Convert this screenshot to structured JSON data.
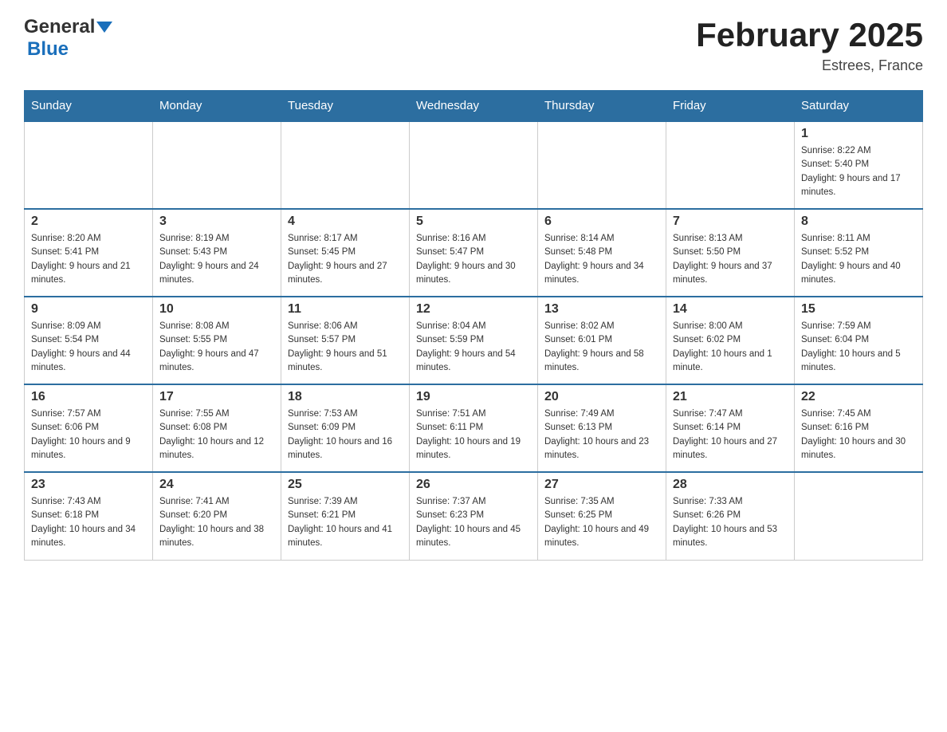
{
  "header": {
    "logo_general": "General",
    "logo_blue": "Blue",
    "month_title": "February 2025",
    "location": "Estrees, France"
  },
  "weekdays": [
    "Sunday",
    "Monday",
    "Tuesday",
    "Wednesday",
    "Thursday",
    "Friday",
    "Saturday"
  ],
  "weeks": [
    [
      {
        "day": "",
        "info": ""
      },
      {
        "day": "",
        "info": ""
      },
      {
        "day": "",
        "info": ""
      },
      {
        "day": "",
        "info": ""
      },
      {
        "day": "",
        "info": ""
      },
      {
        "day": "",
        "info": ""
      },
      {
        "day": "1",
        "info": "Sunrise: 8:22 AM\nSunset: 5:40 PM\nDaylight: 9 hours and 17 minutes."
      }
    ],
    [
      {
        "day": "2",
        "info": "Sunrise: 8:20 AM\nSunset: 5:41 PM\nDaylight: 9 hours and 21 minutes."
      },
      {
        "day": "3",
        "info": "Sunrise: 8:19 AM\nSunset: 5:43 PM\nDaylight: 9 hours and 24 minutes."
      },
      {
        "day": "4",
        "info": "Sunrise: 8:17 AM\nSunset: 5:45 PM\nDaylight: 9 hours and 27 minutes."
      },
      {
        "day": "5",
        "info": "Sunrise: 8:16 AM\nSunset: 5:47 PM\nDaylight: 9 hours and 30 minutes."
      },
      {
        "day": "6",
        "info": "Sunrise: 8:14 AM\nSunset: 5:48 PM\nDaylight: 9 hours and 34 minutes."
      },
      {
        "day": "7",
        "info": "Sunrise: 8:13 AM\nSunset: 5:50 PM\nDaylight: 9 hours and 37 minutes."
      },
      {
        "day": "8",
        "info": "Sunrise: 8:11 AM\nSunset: 5:52 PM\nDaylight: 9 hours and 40 minutes."
      }
    ],
    [
      {
        "day": "9",
        "info": "Sunrise: 8:09 AM\nSunset: 5:54 PM\nDaylight: 9 hours and 44 minutes."
      },
      {
        "day": "10",
        "info": "Sunrise: 8:08 AM\nSunset: 5:55 PM\nDaylight: 9 hours and 47 minutes."
      },
      {
        "day": "11",
        "info": "Sunrise: 8:06 AM\nSunset: 5:57 PM\nDaylight: 9 hours and 51 minutes."
      },
      {
        "day": "12",
        "info": "Sunrise: 8:04 AM\nSunset: 5:59 PM\nDaylight: 9 hours and 54 minutes."
      },
      {
        "day": "13",
        "info": "Sunrise: 8:02 AM\nSunset: 6:01 PM\nDaylight: 9 hours and 58 minutes."
      },
      {
        "day": "14",
        "info": "Sunrise: 8:00 AM\nSunset: 6:02 PM\nDaylight: 10 hours and 1 minute."
      },
      {
        "day": "15",
        "info": "Sunrise: 7:59 AM\nSunset: 6:04 PM\nDaylight: 10 hours and 5 minutes."
      }
    ],
    [
      {
        "day": "16",
        "info": "Sunrise: 7:57 AM\nSunset: 6:06 PM\nDaylight: 10 hours and 9 minutes."
      },
      {
        "day": "17",
        "info": "Sunrise: 7:55 AM\nSunset: 6:08 PM\nDaylight: 10 hours and 12 minutes."
      },
      {
        "day": "18",
        "info": "Sunrise: 7:53 AM\nSunset: 6:09 PM\nDaylight: 10 hours and 16 minutes."
      },
      {
        "day": "19",
        "info": "Sunrise: 7:51 AM\nSunset: 6:11 PM\nDaylight: 10 hours and 19 minutes."
      },
      {
        "day": "20",
        "info": "Sunrise: 7:49 AM\nSunset: 6:13 PM\nDaylight: 10 hours and 23 minutes."
      },
      {
        "day": "21",
        "info": "Sunrise: 7:47 AM\nSunset: 6:14 PM\nDaylight: 10 hours and 27 minutes."
      },
      {
        "day": "22",
        "info": "Sunrise: 7:45 AM\nSunset: 6:16 PM\nDaylight: 10 hours and 30 minutes."
      }
    ],
    [
      {
        "day": "23",
        "info": "Sunrise: 7:43 AM\nSunset: 6:18 PM\nDaylight: 10 hours and 34 minutes."
      },
      {
        "day": "24",
        "info": "Sunrise: 7:41 AM\nSunset: 6:20 PM\nDaylight: 10 hours and 38 minutes."
      },
      {
        "day": "25",
        "info": "Sunrise: 7:39 AM\nSunset: 6:21 PM\nDaylight: 10 hours and 41 minutes."
      },
      {
        "day": "26",
        "info": "Sunrise: 7:37 AM\nSunset: 6:23 PM\nDaylight: 10 hours and 45 minutes."
      },
      {
        "day": "27",
        "info": "Sunrise: 7:35 AM\nSunset: 6:25 PM\nDaylight: 10 hours and 49 minutes."
      },
      {
        "day": "28",
        "info": "Sunrise: 7:33 AM\nSunset: 6:26 PM\nDaylight: 10 hours and 53 minutes."
      },
      {
        "day": "",
        "info": ""
      }
    ]
  ]
}
